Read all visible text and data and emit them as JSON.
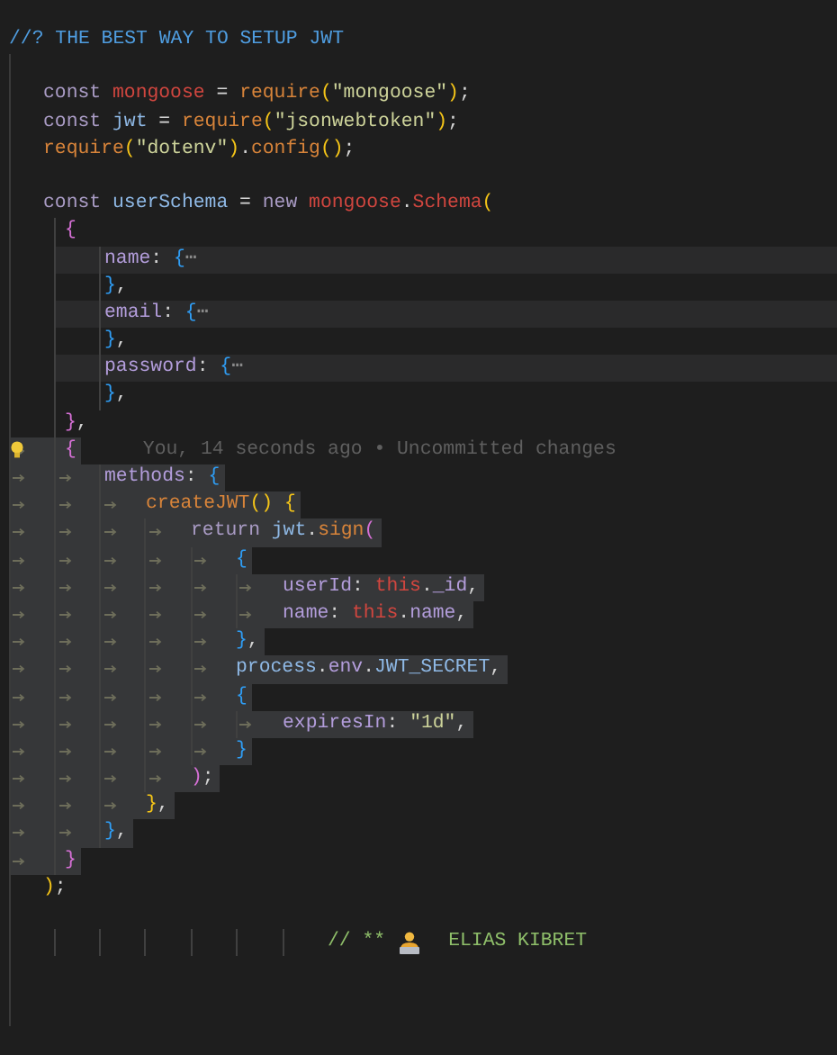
{
  "editor": {
    "lines": [
      {
        "kind": "banner",
        "tokens": [
          {
            "text": "//? THE BEST WAY TO SETUP JWT",
            "kind": "comment-blue"
          }
        ]
      },
      {
        "kind": "blank"
      },
      {
        "kind": "code",
        "selected": false,
        "folded": false,
        "tokens": [
          {
            "text": "const",
            "kind": "keyword"
          },
          {
            "text": " mongoose",
            "kind": "variable"
          },
          {
            "text": " = ",
            "kind": "punct"
          },
          {
            "text": "require",
            "kind": "function"
          },
          {
            "text": "(",
            "kind": "bracket-gold"
          },
          {
            "text": "\"mongoose\"",
            "kind": "string"
          },
          {
            "text": ")",
            "kind": "bracket-gold"
          },
          {
            "text": ";",
            "kind": "punct"
          }
        ]
      },
      {
        "kind": "code",
        "selected": false,
        "folded": false,
        "tokens": [
          {
            "text": "const",
            "kind": "keyword"
          },
          {
            "text": " jwt",
            "kind": "identifier"
          },
          {
            "text": " = ",
            "kind": "punct"
          },
          {
            "text": "require",
            "kind": "function"
          },
          {
            "text": "(",
            "kind": "bracket-gold"
          },
          {
            "text": "\"jsonwebtoken\"",
            "kind": "string"
          },
          {
            "text": ")",
            "kind": "bracket-gold"
          },
          {
            "text": ";",
            "kind": "punct"
          }
        ]
      },
      {
        "kind": "code",
        "selected": false,
        "folded": false,
        "tokens": [
          {
            "text": "require",
            "kind": "function"
          },
          {
            "text": "(",
            "kind": "bracket-gold"
          },
          {
            "text": "\"dotenv\"",
            "kind": "string"
          },
          {
            "text": ")",
            "kind": "bracket-gold"
          },
          {
            "text": ".",
            "kind": "punct"
          },
          {
            "text": "config",
            "kind": "function"
          },
          {
            "text": "()",
            "kind": "bracket-gold"
          },
          {
            "text": ";",
            "kind": "punct"
          }
        ]
      },
      {
        "kind": "blank"
      },
      {
        "kind": "code",
        "selected": false,
        "folded": false,
        "tokens": [
          {
            "text": "const",
            "kind": "keyword"
          },
          {
            "text": " userSchema",
            "kind": "identifier"
          },
          {
            "text": " = ",
            "kind": "punct"
          },
          {
            "text": "new",
            "kind": "keyword"
          },
          {
            "text": " mongoose",
            "kind": "variable"
          },
          {
            "text": ".",
            "kind": "punct"
          },
          {
            "text": "Schema",
            "kind": "variable"
          },
          {
            "text": "(",
            "kind": "bracket-gold"
          }
        ],
        "children": [
          {
            "kind": "code",
            "selected": false,
            "folded": false,
            "tokens": [
              {
                "text": "{",
                "kind": "bracket-purple"
              }
            ],
            "children": [
              {
                "kind": "code",
                "selected": false,
                "folded": true,
                "tokens": [
                  {
                    "text": "name",
                    "kind": "property"
                  },
                  {
                    "text": ": ",
                    "kind": "punct"
                  },
                  {
                    "text": "{",
                    "kind": "bracket-blue"
                  },
                  {
                    "text": "⋯",
                    "kind": "fold"
                  }
                ]
              },
              {
                "kind": "code",
                "selected": false,
                "folded": false,
                "tokens": [
                  {
                    "text": "}",
                    "kind": "bracket-blue"
                  },
                  {
                    "text": ",",
                    "kind": "punct"
                  }
                ]
              },
              {
                "kind": "code",
                "selected": false,
                "folded": true,
                "tokens": [
                  {
                    "text": "email",
                    "kind": "property"
                  },
                  {
                    "text": ": ",
                    "kind": "punct"
                  },
                  {
                    "text": "{",
                    "kind": "bracket-blue"
                  },
                  {
                    "text": "⋯",
                    "kind": "fold"
                  }
                ]
              },
              {
                "kind": "code",
                "selected": false,
                "folded": false,
                "tokens": [
                  {
                    "text": "}",
                    "kind": "bracket-blue"
                  },
                  {
                    "text": ",",
                    "kind": "punct"
                  }
                ]
              },
              {
                "kind": "code",
                "selected": false,
                "folded": true,
                "tokens": [
                  {
                    "text": "password",
                    "kind": "property"
                  },
                  {
                    "text": ": ",
                    "kind": "punct"
                  },
                  {
                    "text": "{",
                    "kind": "bracket-blue"
                  },
                  {
                    "text": "⋯",
                    "kind": "fold"
                  }
                ]
              },
              {
                "kind": "code",
                "selected": false,
                "folded": false,
                "tokens": [
                  {
                    "text": "}",
                    "kind": "bracket-blue"
                  },
                  {
                    "text": ",",
                    "kind": "punct"
                  }
                ]
              }
            ]
          },
          {
            "kind": "code",
            "selected": false,
            "folded": false,
            "tokens": [
              {
                "text": "}",
                "kind": "bracket-purple"
              },
              {
                "text": ",",
                "kind": "punct"
              }
            ]
          },
          {
            "kind": "code",
            "selected": true,
            "folded": false,
            "lightbulb": true,
            "annotation": "You, 14 seconds ago • Uncommitted changes",
            "tokens": [
              {
                "text": "{",
                "kind": "bracket-purple"
              }
            ],
            "children": [
              {
                "kind": "code",
                "selected": true,
                "folded": false,
                "tokens": [
                  {
                    "text": "methods",
                    "kind": "property"
                  },
                  {
                    "text": ": ",
                    "kind": "punct"
                  },
                  {
                    "text": "{",
                    "kind": "bracket-blue"
                  }
                ],
                "children": [
                  {
                    "kind": "code",
                    "selected": true,
                    "folded": false,
                    "tokens": [
                      {
                        "text": "createJWT",
                        "kind": "function"
                      },
                      {
                        "text": "() {",
                        "kind": "bracket-gold"
                      }
                    ],
                    "children": [
                      {
                        "kind": "code",
                        "selected": true,
                        "folded": false,
                        "tokens": [
                          {
                            "text": "return",
                            "kind": "keyword"
                          },
                          {
                            "text": " jwt",
                            "kind": "identifier"
                          },
                          {
                            "text": ".",
                            "kind": "punct"
                          },
                          {
                            "text": "sign",
                            "kind": "function"
                          },
                          {
                            "text": "(",
                            "kind": "bracket-purple"
                          }
                        ],
                        "children": [
                          {
                            "kind": "code",
                            "selected": true,
                            "folded": false,
                            "tokens": [
                              {
                                "text": "{",
                                "kind": "bracket-blue"
                              }
                            ],
                            "children": [
                              {
                                "kind": "code",
                                "selected": true,
                                "folded": false,
                                "tokens": [
                                  {
                                    "text": "userId",
                                    "kind": "property"
                                  },
                                  {
                                    "text": ": ",
                                    "kind": "punct"
                                  },
                                  {
                                    "text": "this",
                                    "kind": "variable"
                                  },
                                  {
                                    "text": ".",
                                    "kind": "punct"
                                  },
                                  {
                                    "text": "_id",
                                    "kind": "property"
                                  },
                                  {
                                    "text": ",",
                                    "kind": "punct"
                                  }
                                ]
                              },
                              {
                                "kind": "code",
                                "selected": true,
                                "folded": false,
                                "tokens": [
                                  {
                                    "text": "name",
                                    "kind": "property"
                                  },
                                  {
                                    "text": ": ",
                                    "kind": "punct"
                                  },
                                  {
                                    "text": "this",
                                    "kind": "variable"
                                  },
                                  {
                                    "text": ".",
                                    "kind": "punct"
                                  },
                                  {
                                    "text": "name",
                                    "kind": "property"
                                  },
                                  {
                                    "text": ",",
                                    "kind": "punct"
                                  }
                                ]
                              }
                            ]
                          },
                          {
                            "kind": "code",
                            "selected": true,
                            "folded": false,
                            "tokens": [
                              {
                                "text": "}",
                                "kind": "bracket-blue"
                              },
                              {
                                "text": ",",
                                "kind": "punct"
                              }
                            ]
                          },
                          {
                            "kind": "code",
                            "selected": true,
                            "folded": false,
                            "tokens": [
                              {
                                "text": "process",
                                "kind": "identifier"
                              },
                              {
                                "text": ".",
                                "kind": "punct"
                              },
                              {
                                "text": "env",
                                "kind": "property"
                              },
                              {
                                "text": ".",
                                "kind": "punct"
                              },
                              {
                                "text": "JWT_SECRET",
                                "kind": "identifier"
                              },
                              {
                                "text": ",",
                                "kind": "punct"
                              }
                            ]
                          },
                          {
                            "kind": "code",
                            "selected": true,
                            "folded": false,
                            "tokens": [
                              {
                                "text": "{",
                                "kind": "bracket-blue"
                              }
                            ],
                            "children": [
                              {
                                "kind": "code",
                                "selected": true,
                                "folded": false,
                                "tokens": [
                                  {
                                    "text": "expiresIn",
                                    "kind": "property"
                                  },
                                  {
                                    "text": ": ",
                                    "kind": "punct"
                                  },
                                  {
                                    "text": "\"1d\"",
                                    "kind": "string"
                                  },
                                  {
                                    "text": ",",
                                    "kind": "punct"
                                  }
                                ]
                              }
                            ]
                          },
                          {
                            "kind": "code",
                            "selected": true,
                            "folded": false,
                            "tokens": [
                              {
                                "text": "}",
                                "kind": "bracket-blue"
                              }
                            ]
                          }
                        ]
                      },
                      {
                        "kind": "code",
                        "selected": true,
                        "folded": false,
                        "tokens": [
                          {
                            "text": ")",
                            "kind": "bracket-purple"
                          },
                          {
                            "text": ";",
                            "kind": "punct"
                          }
                        ]
                      }
                    ]
                  },
                  {
                    "kind": "code",
                    "selected": true,
                    "folded": false,
                    "tokens": [
                      {
                        "text": "}",
                        "kind": "bracket-gold"
                      },
                      {
                        "text": ",",
                        "kind": "punct"
                      }
                    ]
                  }
                ]
              },
              {
                "kind": "code",
                "selected": true,
                "folded": false,
                "tokens": [
                  {
                    "text": "}",
                    "kind": "bracket-blue"
                  },
                  {
                    "text": ",",
                    "kind": "punct"
                  }
                ]
              }
            ]
          },
          {
            "kind": "code",
            "selected": true,
            "folded": false,
            "tokens": [
              {
                "text": "}",
                "kind": "bracket-purple"
              }
            ]
          }
        ]
      },
      {
        "kind": "code",
        "selected": false,
        "folded": false,
        "tokens": [
          {
            "text": ")",
            "kind": "bracket-gold"
          },
          {
            "text": ";",
            "kind": "punct"
          }
        ]
      },
      {
        "kind": "blank"
      },
      {
        "kind": "signature",
        "tokens": [
          {
            "text": "// **",
            "kind": "comment-green"
          },
          {
            "kind": "person-icon"
          },
          {
            "text": "ELIAS KIBRET",
            "kind": "comment-green"
          }
        ]
      }
    ]
  }
}
